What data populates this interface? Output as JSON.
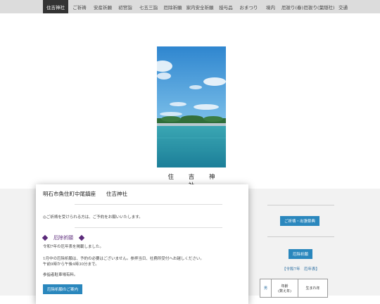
{
  "nav": {
    "items": [
      "住吉神社",
      "ご祈祷",
      "安産祈願",
      "初宮詣",
      "七五三詣",
      "厄除祈願",
      "家内安全祈願",
      "授与品",
      "おまつり",
      "境内",
      "厄祓り(春)",
      "厄祓り(葉隠社)",
      "交通"
    ],
    "active_index": 0
  },
  "hero": {
    "title": "住 吉 神 社"
  },
  "card": {
    "title": "明石市魚住町中尾鎮座　　住吉神社",
    "notice": "◎ご祈祷を受けられる方は、ご予約をお願いいたします。",
    "section_title": "厄除祈願",
    "lines": [
      "令和7年の厄年表を掲載しました。",
      "1月中の厄除祈願は、予約の必要はございません。参拝当日、社務所受付へお越しください。",
      "午前9時から午後4時30分まで。",
      "参詣者駐車場有料。"
    ],
    "button_label": "厄除祈願のご案内"
  },
  "sidebar": {
    "btn1": "ご祈祷・出張祭典",
    "btn2": "厄除祈願",
    "caption": "【令和7年　厄年表】",
    "table": {
      "col1": "男",
      "col2": "年齢\n(数え年)",
      "col3": "生まれ年"
    }
  }
}
